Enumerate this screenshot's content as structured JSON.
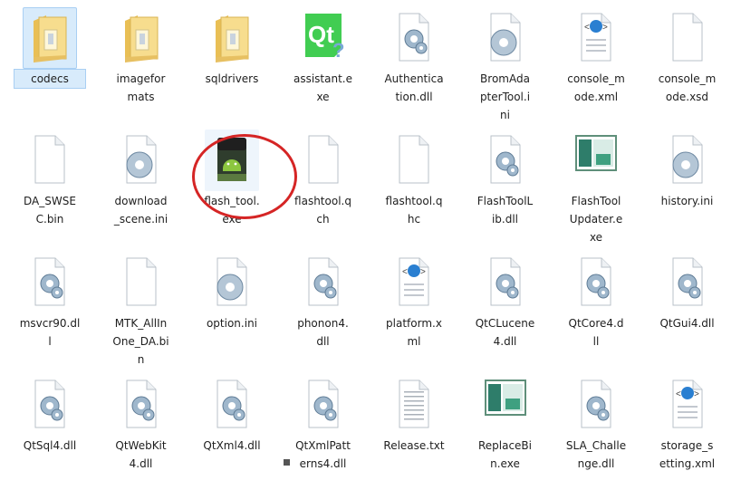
{
  "window": {
    "title": ""
  },
  "files": [
    {
      "name": "codecs",
      "icon": "folder-icon",
      "selected": true
    },
    {
      "name": "imageformats",
      "display": "imagefor\nmats",
      "icon": "folder-icon"
    },
    {
      "name": "sqldrivers",
      "icon": "folder-icon"
    },
    {
      "name": "assistant.exe",
      "display": "assistant.e\nxe",
      "icon": "qt-assistant-icon"
    },
    {
      "name": "Authentication.dll",
      "display": "Authentica\ntion.dll",
      "icon": "dll-icon"
    },
    {
      "name": "BromAdapterTool.ini",
      "display": "BromAda\npterTool.i\nni",
      "icon": "settings-file-icon"
    },
    {
      "name": "console_mode.xml",
      "display": "console_m\node.xml",
      "icon": "xml-file-icon"
    },
    {
      "name": "console_mode.xsd",
      "display": "console_m\node.xsd",
      "icon": "blank-file-icon"
    },
    {
      "name": "DA_SWSEC.bin",
      "display": "DA_SWSE\nC.bin",
      "icon": "blank-file-icon"
    },
    {
      "name": "download_scene.ini",
      "display": "download\n_scene.ini",
      "icon": "settings-file-icon"
    },
    {
      "name": "flash_tool.exe",
      "display": "flash_tool.\nexe",
      "icon": "android-flash-tool-icon",
      "highlighted": true
    },
    {
      "name": "flashtool.qch",
      "display": "flashtool.q\nch",
      "icon": "blank-file-icon"
    },
    {
      "name": "flashtool.qhc",
      "display": "flashtool.q\nhc",
      "icon": "blank-file-icon"
    },
    {
      "name": "FlashToolLib.dll",
      "display": "FlashToolL\nib.dll",
      "icon": "dll-icon"
    },
    {
      "name": "FlashToolUpdater.exe",
      "display": "FlashTool\nUpdater.e\nxe",
      "icon": "app-window-icon"
    },
    {
      "name": "history.ini",
      "icon": "settings-file-icon"
    },
    {
      "name": "msvcr90.dll",
      "display": "msvcr90.dl\nl",
      "icon": "dll-icon"
    },
    {
      "name": "MTK_AllInOne_DA.bin",
      "display": "MTK_AllIn\nOne_DA.bi\nn",
      "icon": "blank-file-icon"
    },
    {
      "name": "option.ini",
      "icon": "settings-file-icon"
    },
    {
      "name": "phonon4.dll",
      "display": "phonon4.\ndll",
      "icon": "dll-icon"
    },
    {
      "name": "platform.xml",
      "display": "platform.x\nml",
      "icon": "xml-file-icon"
    },
    {
      "name": "QtCLucene4.dll",
      "display": "QtCLucene\n4.dll",
      "icon": "dll-icon"
    },
    {
      "name": "QtCore4.dll",
      "display": "QtCore4.d\nll",
      "icon": "dll-icon"
    },
    {
      "name": "QtGui4.dll",
      "icon": "dll-icon"
    },
    {
      "name": "QtSql4.dll",
      "icon": "dll-icon"
    },
    {
      "name": "QtWebKit4.dll",
      "display": "QtWebKit\n4.dll",
      "icon": "dll-icon"
    },
    {
      "name": "QtXml4.dll",
      "icon": "dll-icon"
    },
    {
      "name": "QtXmlPatterns4.dll",
      "display": "QtXmlPatt\nerns4.dll",
      "icon": "dll-icon"
    },
    {
      "name": "Release.txt",
      "icon": "text-file-icon"
    },
    {
      "name": "ReplaceBin.exe",
      "display": "ReplaceBi\nn.exe",
      "icon": "app-window-icon"
    },
    {
      "name": "SLA_Challenge.dll",
      "display": "SLA_Challe\nnge.dll",
      "icon": "dll-icon"
    },
    {
      "name": "storage_setting.xml",
      "display": "storage_s\netting.xml",
      "icon": "xml-file-icon"
    }
  ],
  "colors": {
    "selection": "#d8ebfb",
    "highlight_circle": "#d52525",
    "folder": "#f5d67a",
    "android": "#8cc63f"
  }
}
